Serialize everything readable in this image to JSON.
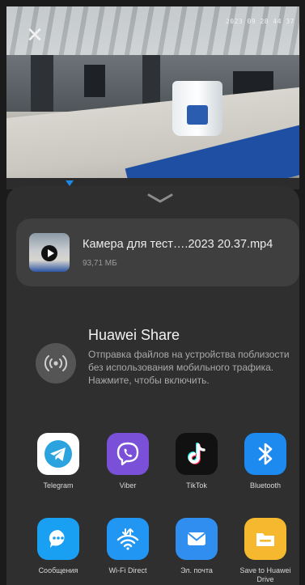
{
  "video": {
    "close_glyph": "✕",
    "timestamp": "2023 09 28 44 37"
  },
  "file": {
    "name": "Камера для тест….2023 20.37.mp4",
    "size": "93,71 МБ"
  },
  "huawei_share": {
    "title": "Huawei Share",
    "description": "Отправка файлов на устройства поблизости без использования мобильного трафика. Нажмите, чтобы включить."
  },
  "apps": [
    {
      "label": "Telegram",
      "icon": "telegram-icon",
      "color": "#ffffff"
    },
    {
      "label": "Viber",
      "icon": "viber-icon",
      "color": "#7b50d8"
    },
    {
      "label": "TikTok",
      "icon": "tiktok-icon",
      "color": "#111111"
    },
    {
      "label": "Bluetooth",
      "icon": "bluetooth-icon",
      "color": "#1d8af0"
    },
    {
      "label": "Сообщения",
      "icon": "messages-icon",
      "color": "#1aa0f2"
    },
    {
      "label": "Wi-Fi Direct",
      "icon": "wifi-direct-icon",
      "color": "#2196f3"
    },
    {
      "label": "Эл. почта",
      "icon": "email-icon",
      "color": "#2f8ef0"
    },
    {
      "label": "Save to Huawei Drive",
      "icon": "huawei-drive-icon",
      "color": "#f5b82e"
    }
  ],
  "colors": {
    "sheet_bg": "#2f2f2f",
    "card_bg": "#3f3f3f",
    "accent_marker": "#1e88e5"
  }
}
